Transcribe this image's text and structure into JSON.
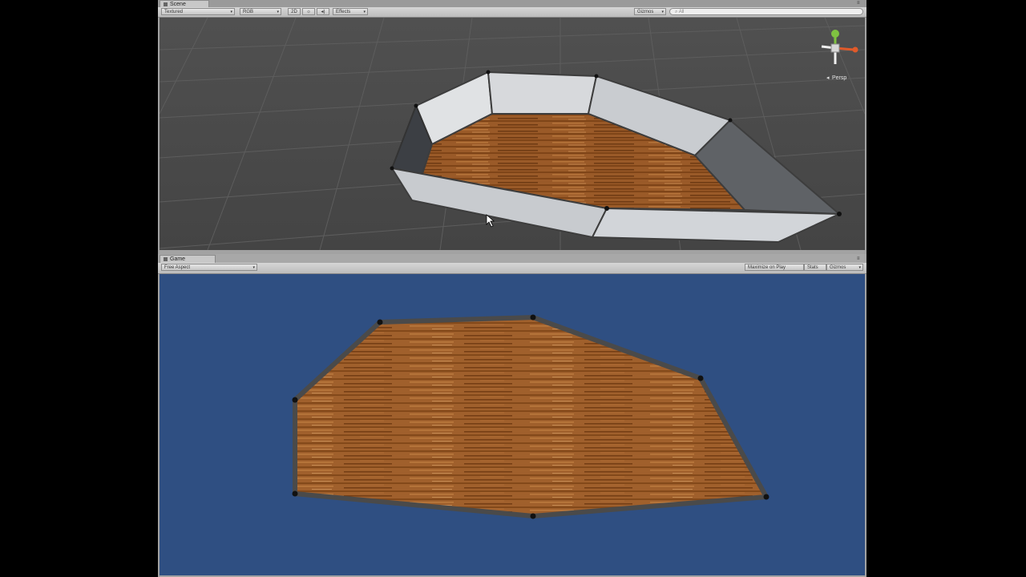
{
  "scene_panel": {
    "tab_label": "Scene",
    "render_mode": "Textured",
    "color_mode": "RGB",
    "toggle_2d": "2D",
    "lighting_icon": "sun-icon",
    "audio_icon": "speaker-icon",
    "effects_label": "Effects",
    "gizmos_label": "Gizmos",
    "search_placeholder": "All",
    "persp_label": "Persp",
    "background_color": "#4a4a4a"
  },
  "game_panel": {
    "tab_label": "Game",
    "aspect": "Free Aspect",
    "maximize_on_play": "Maximize on Play",
    "stats": "Stats",
    "gizmos_label": "Gizmos",
    "background_color": "#2f4f82"
  },
  "colors": {
    "floor_wood": "#9a5a28",
    "wall_light": "#c9ccd0",
    "outline": "#4a4a4a"
  }
}
